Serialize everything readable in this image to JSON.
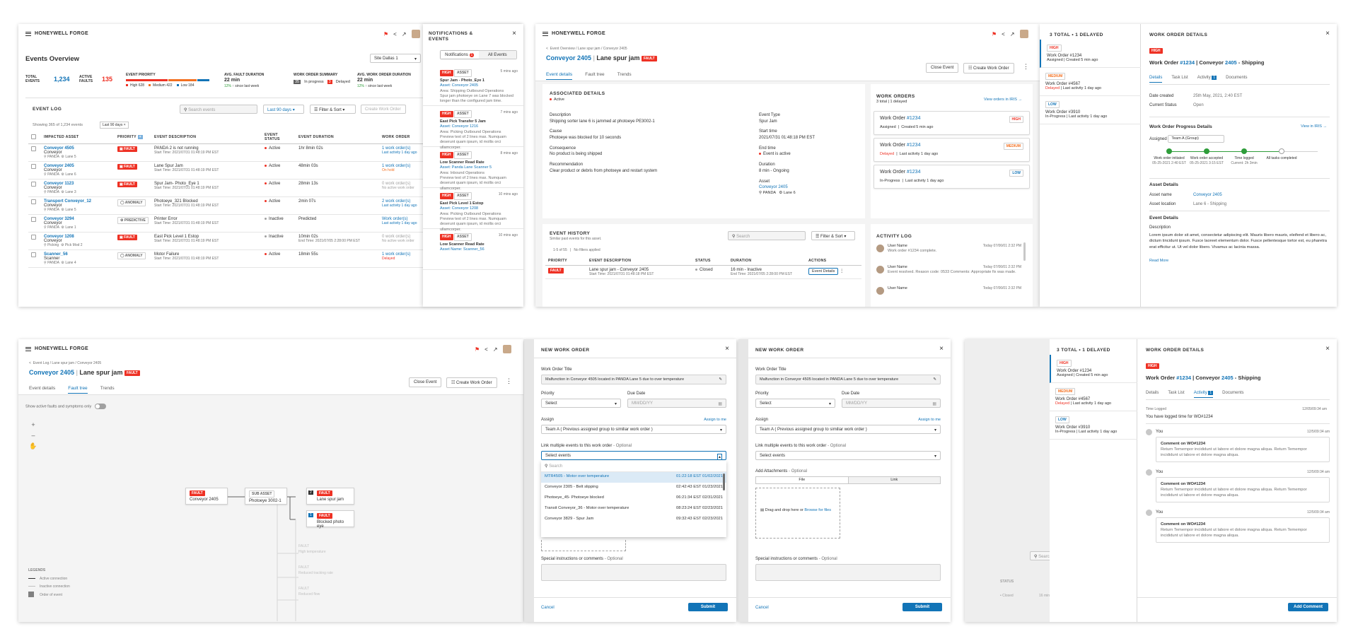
{
  "brand": "HONEYWELL FORGE",
  "panel1": {
    "title": "Events Overview",
    "site": "Site Dallas 1",
    "kpis": {
      "total_label": "TOTAL EVENTS",
      "total": "1,234",
      "active_label": "ACTIVE FAULTS",
      "active": "135",
      "priority_label": "EVENT PRIORITY",
      "priority": [
        {
          "label": "High",
          "value": "628",
          "color": "#ee3124"
        },
        {
          "label": "Medium",
          "value": "422",
          "color": "#f37021"
        },
        {
          "label": "Low",
          "value": "184",
          "color": "#1274b7"
        }
      ],
      "afd_label": "AVG. FAULT DURATION",
      "afd": "22 min",
      "afd_change": "12%",
      "afd_since": "since last week",
      "wos_label": "WORK ORDER SUMMARY",
      "wos_inprogress_n": "35",
      "wos_inprogress": "In progress",
      "wos_delayed_n": "3",
      "wos_delayed": "Delayed",
      "awd_label": "AVG. WORK ORDER DURATION",
      "awd": "22 min",
      "awd_change": "12%",
      "awd_since": "since last week"
    },
    "log": {
      "title": "EVENT LOG",
      "search_placeholder": "Search events",
      "range": "Last 90 days",
      "filter": "Filter & Sort",
      "create": "Create Work Order",
      "showing": "Showing 365 of 1,234 events",
      "chip": "Last 90 days",
      "columns": [
        "IMPACTED ASSET",
        "PRIORITY",
        "EVENT DESCRIPTION",
        "EVENT STATUS",
        "EVENT DURATION",
        "WORK ORDER"
      ],
      "rows": [
        {
          "asset": "Conveyor 4505",
          "type": "Conveyor",
          "loc": "PANDA",
          "lane": "Lane 5",
          "priority": "FAULT",
          "desc": "PANDA 2 is not running",
          "start": "Start Time: 2021/07/31 01:48:19 PM EST",
          "status": "Active",
          "dur": "1hr 8min 02s",
          "wo": "1 work order(s)",
          "wo2": "Last activity 1 day ago",
          "wo2color": "blue"
        },
        {
          "asset": "Conveyor 2405",
          "type": "Conveyor",
          "loc": "PANDA",
          "lane": "Lane 6",
          "priority": "FAULT",
          "desc": "Lane Spur Jam",
          "start": "Start Time: 2021/07/31 01:48:19 PM EST",
          "status": "Active",
          "dur": "48min 03s",
          "wo": "1 work order(s)",
          "wo2": "On hold",
          "wo2color": "orange"
        },
        {
          "asset": "Conveyor 1123",
          "type": "Conveyor",
          "loc": "PANDA",
          "lane": "Lane 3",
          "priority": "FAULT",
          "desc": "Spur Jam- Photo_Eye 1",
          "start": "Start Time: 2021/07/31 01:48:19 PM EST",
          "status": "Active",
          "dur": "28min 13s",
          "wo": "0 work order(s)",
          "wo2": "No active work order",
          "wo2color": "grey"
        },
        {
          "asset": "Transport Conveyor_12",
          "type": "Conveyor",
          "loc": "PANDA",
          "lane": "Lane 5",
          "priority": "ANOMALY",
          "desc": "Photoeye_321 Blocked",
          "start": "Start Time: 2021/07/31 01:48:19 PM EST",
          "status": "Active",
          "dur": "2min 07s",
          "wo": "2 work order(s)",
          "wo2": "Last activity 1 day ago",
          "wo2color": "blue"
        },
        {
          "asset": "Conveyor 3294",
          "type": "Conveyor",
          "loc": "PANDA",
          "lane": "Lane 1",
          "priority": "PREDICTIVE",
          "desc": "Printer Error",
          "start": "Start Time: 2021/07/31 01:48:19 PM EST",
          "status": "Inactive",
          "dur": "Predicted",
          "wo": "Work order(s)",
          "wo2": "Last activity 1 day ago",
          "wo2color": "blue"
        },
        {
          "asset": "Conveyor 1208",
          "type": "Conveyor",
          "loc": "Picking",
          "lane": "Pick Mod 2",
          "priority": "FAULT",
          "desc": "East Pick Level 1 Estop",
          "start": "Start Time: 2021/07/31 01:48:19 PM EST",
          "status": "Inactive",
          "dur": "10min 02s",
          "dur2": "End Time: 2021/07/05 2:28:00 PM EST",
          "wo": "0 work order(s)",
          "wo2": "No active work order",
          "wo2color": "grey"
        },
        {
          "asset": "Scanner_56",
          "type": "Scanner",
          "loc": "PANDA",
          "lane": "Lane 4",
          "priority": "ANOMALY",
          "desc": "Motor Failure",
          "start": "Start Time: 2021/07/31 01:48:19 PM EST",
          "status": "Active",
          "dur": "18min 55s",
          "wo": "1 work order(s)",
          "wo2": "Delayed",
          "wo2color": "red"
        }
      ]
    }
  },
  "notif": {
    "title": "NOTIFICATIONS & EVENTS",
    "tab1": "Notifications",
    "tab1_badge": "1",
    "tab2": "All Events",
    "items": [
      {
        "tag": "HIGH",
        "tag2": "ASSET",
        "time": "5 mins ago",
        "title": "Spur Jam - Photo_Eye 1",
        "link": "Asset: Conveyor 2405",
        "area": "Area: Shipping Outbound Operations",
        "body": "Spur jam photoeye on Lane 7 was blocked longer than the configured jam time."
      },
      {
        "tag": "HIGH",
        "tag2": "ASSET",
        "time": "7 mins ago",
        "title": "East Pick Transfer 5 Jam",
        "link": "Asset: Conveyor 1216",
        "area": "Area: Picking Outbound Operations",
        "body": "Preview text of 2 lines max. Numquam deserunt quam ipsum, id mollis orci ullamcorper."
      },
      {
        "tag": "HIGH",
        "tag2": "ASSET",
        "time": "8 mins ago",
        "title": "Low Scanner Read Rate",
        "link": "Asset: Panda Lane Scanner 5",
        "area": "Area: Inbound Operations",
        "body": "Preview text of 2 lines max. Numquam deserunt quam ipsum, id mollis orci ullamcorper."
      },
      {
        "tag": "HIGH",
        "tag2": "ASSET",
        "time": "10 mins ago",
        "title": "East Pick Level 1 Estop",
        "link": "Asset: Conveyor 1208",
        "area": "Area: Picking Outbound Operations",
        "body": "Preview text of 2 lines max. Numquam deserunt quam ipsum, id mollis orci ullamcorper."
      },
      {
        "tag": "HIGH",
        "tag2": "ASSET",
        "time": "10 mins ago",
        "title": "Low Scanner Read Rate",
        "link": "Asset Name: Scanner_56",
        "area": "",
        "body": ""
      }
    ]
  },
  "detail": {
    "crumb": "Event Overview / Lane spur jam / Conveyor 2405",
    "asset": "Conveyor 2405",
    "event": "Lane spur jam",
    "badge": "FAULT",
    "close_event": "Close Event",
    "create_wo": "Create Work Order",
    "tabs": [
      "Event details",
      "Fault tree",
      "Trends"
    ],
    "assoc_title": "ASSOCIATED DETAILS",
    "assoc_status": "Active",
    "desc_label": "Description",
    "desc": "Shipping sorter lane 6 is jammed at photoeye PE3002-1",
    "cause_label": "Cause",
    "cause": "Photoeye was blocked for 10 seconds",
    "cons_label": "Consequence",
    "cons": "No product is being shipped",
    "rec_label": "Recommendation",
    "rec": "Clear product or debris from photoeye and restart system",
    "type_label": "Event Type",
    "type": "Spur Jam",
    "start_label": "Start time",
    "start": "2021/07/31 01:48:18 PM EST",
    "end_label": "End time",
    "end": "Event is active",
    "dur_label": "Duration",
    "dur": "8 min - Ongoing",
    "asset_label": "Asset",
    "asset_link": "Conveyor 2405",
    "asset_loc": "PANDA",
    "asset_lane": "Lane 6",
    "wo_title": "WORK ORDERS",
    "wo_sub": "3 total | 1 delayed",
    "wo_link": "View orders in IRIS",
    "wos": [
      {
        "name": "Work Order ",
        "num": "#1234",
        "tag": "HIGH",
        "status": "Assigned",
        "meta": "Created 5 min ago"
      },
      {
        "name": "Work Order ",
        "num": "#1234",
        "tag": "MEDIUM",
        "status": "Delayed",
        "meta": "Last activity 1 day ago"
      },
      {
        "name": "Work Order ",
        "num": "#1234",
        "tag": "LOW",
        "status": "In-Progress",
        "meta": "Last activity 1 day ago"
      }
    ],
    "hist_title": "EVENT HISTORY",
    "hist_sub": "Similar past events for this asset.",
    "hist_search": "Search",
    "hist_filter": "Filter & Sort",
    "hist_count": "1-5 of 55",
    "hist_nofilter": "No filters applied",
    "hist_cols": [
      "PRIORITY",
      "EVENT DESCRIPTION",
      "STATUS",
      "DURATION",
      "ACTIONS"
    ],
    "hist_row": {
      "desc": "Lane spur jam - Conveyor 2405",
      "start": "Start Time: 2021/07/31 01:48:18 PM EST",
      "status": "Closed",
      "dur": "16 min - Inactive",
      "end": "End Time: 2021/07/05 2:28:00 PM EST",
      "action": "Event Details"
    },
    "act_title": "ACTIVITY LOG",
    "acts": [
      {
        "user": "User Name",
        "time": "Today 07/06/01 2:32 PM",
        "text": "Work order #1234 complete."
      },
      {
        "user": "User Name",
        "time": "Today 07/06/01 2:32 PM",
        "text": "Event resolved. Reason code: 0533 Comments: Appropriate fix was made."
      },
      {
        "user": "User Name",
        "time": "Today 07/06/01 2:32 PM",
        "text": ""
      }
    ]
  },
  "wopanel": {
    "list_title": "3 TOTAL • 1 DELAYED",
    "list": [
      {
        "tag": "HIGH",
        "name": "Work Order #1234",
        "status": "Assigned",
        "meta": "Created 5 min ago"
      },
      {
        "tag": "MEDIUM",
        "name": "Work Order #4567",
        "status": "Delayed",
        "meta": "Last activity 1 day ago"
      },
      {
        "tag": "LOW",
        "name": "Work Order #3910",
        "status": "In-Progress",
        "meta": "Last activity 1 day ago"
      }
    ],
    "title": "WORK ORDER DETAILS",
    "tag": "HIGH",
    "wo_pre": "Work Order ",
    "wo_num": "#1234",
    "wo_mid": " | Conveyor ",
    "wo_asset": "2405",
    "wo_post": " - Shipping",
    "tabs": [
      "Details",
      "Task List",
      "Activity",
      "Documents"
    ],
    "activity_badge": "1",
    "date_label": "Date created",
    "date": "25th May, 2021, 2:40 EST",
    "status_label": "Current Status",
    "status": "Open",
    "progress_title": "Work Order Progress Details",
    "iris": "View in IRIS",
    "assigned_label": "Assigned",
    "assigned": "Team A (Group)",
    "steps": [
      {
        "label": "Work order initiated",
        "date": "05-25-2021 2:40 EST"
      },
      {
        "label": "Work order accepted",
        "date": "05-25-2021 3:15 EST"
      },
      {
        "label": "Time logged",
        "date": "Current: 2h 3min"
      },
      {
        "label": "All tasks completed",
        "date": ""
      }
    ],
    "asset_title": "Asset Details",
    "asset_name_label": "Asset name",
    "asset_name": "Conveyor 2405",
    "asset_loc_label": "Asset location",
    "asset_loc": "Lane 6 - Shipping",
    "event_title": "Event Details",
    "desc_label": "Description",
    "desc": "Lorem ipsum dolor sit amet, consectetur adipiscing elit. Mauris libero mauris, eleifend et libero ac, dictum tincidunt ipsum. Fusce laoreet elementum dolor. Fusce pellentesque tortor est, eu pharetra erat efficitur ut. Ut vel dolor libero. Vivamus ac lacinia massa.",
    "read_more": "Read More",
    "time_logged": "Time Logged",
    "time_logged_date": "12/05/09:34 am",
    "time_logged_text": "You have logged time for WO#1234",
    "comment_user": "You",
    "comment_time": "12/5/09:34 am",
    "comment_title": "Comment on WO#1234",
    "comment_text": "Return Temempor incididunt ut labore et dolore magna aliqua. Return Temempor incididunt ut labore et dolore magna aliqua.",
    "add_comment": "Add Comment"
  },
  "tree": {
    "crumb": "Event Log / Lane spur jam / Conveyor 2405",
    "toggle_label": "Show active faults and symptoms only",
    "nodes": [
      {
        "tag": "FAULT",
        "name": "Conveyor 2405"
      },
      {
        "tag": "SUB ASSET",
        "name": "Photoeye 3002-1"
      },
      {
        "tag": "FAULT",
        "name": "Lane spur jam",
        "num": "2"
      },
      {
        "tag": "FAULT",
        "name": "Blocked photo eye",
        "num": "1"
      }
    ],
    "faded": [
      "FAULT",
      "High temperature",
      "FAULT",
      "Reduced tracking rate",
      "FAULT",
      "Reduced flow"
    ],
    "legend_title": "LEGENDS",
    "legend": [
      "Active connection",
      "Inactive connection",
      "Order of event"
    ]
  },
  "newwo": {
    "title": "NEW WORK ORDER",
    "wo_title_label": "Work Order Title",
    "wo_title_value": "Malfunction in Conveyor 4505 located in PANDA Lane 5 due to over temperature",
    "priority_label": "Priority",
    "priority_value": "Select",
    "due_label": "Due Date",
    "due_placeholder": "MM/DD/YY",
    "assign_label": "Assign",
    "assign_me": "Assign to me",
    "assign_value": "Team A ( Previous assigned group to similiar work order )",
    "link_label": "Link multiple events to this work order",
    "optional": "- Optional",
    "select_events": "Select events",
    "dd_search": "Search",
    "dd_items": [
      {
        "name": "MTR4505 - Motor over temperature",
        "time": "01:22:18 EST 01/02/2021"
      },
      {
        "name": "Conveyor 2305 - Belt slipping",
        "time": "02:42:43 EST 01/23/2021"
      },
      {
        "name": "Photoeye_45- Photoeye blocked",
        "time": "06:21:34 EST 02/31/2021"
      },
      {
        "name": "Transit Conveyor_36 - Motor over temperature",
        "time": "08:23:24 EST 02/23/2021"
      },
      {
        "name": "Conveyor 3829 - Spur Jam",
        "time": "09:32:43 EST 02/23/2021"
      }
    ],
    "attach_label": "Add Attachments",
    "file_tab": "File",
    "link_tab": "Link",
    "drop_text": "Drag and drop here or",
    "browse": "Browse for files",
    "special_label": "Special instructions or comments",
    "cancel": "Cancel",
    "submit": "Submit"
  },
  "wopanel2": {
    "bg_search": "Search",
    "bg_status": "STATUS",
    "bg_closed": "Closed",
    "bg_dur": "16 min"
  }
}
